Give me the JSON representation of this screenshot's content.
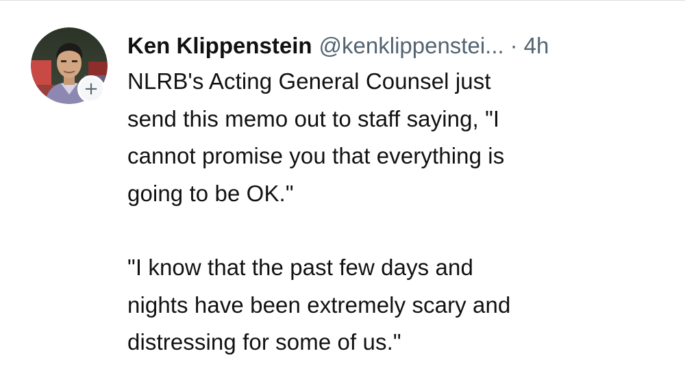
{
  "tweet": {
    "author": {
      "display_name": "Ken Klippenstein",
      "handle": "@kenklippenstei...",
      "separator": "·",
      "timestamp": "4h",
      "avatar_icon": "profile-photo",
      "follow_symbol": "+"
    },
    "paragraphs": [
      {
        "lines": [
          "NLRB's Acting General Counsel just",
          "send this memo out to staff saying, \"I",
          "cannot promise you that everything is",
          "going to be OK.\""
        ]
      },
      {
        "lines": [
          "\"I know that the past few days and",
          "nights have been extremely scary and",
          "distressing for some of us.\""
        ]
      }
    ]
  },
  "colors": {
    "text": "#111111",
    "muted": "#536471",
    "badge_bg": "#f4f6f8"
  }
}
